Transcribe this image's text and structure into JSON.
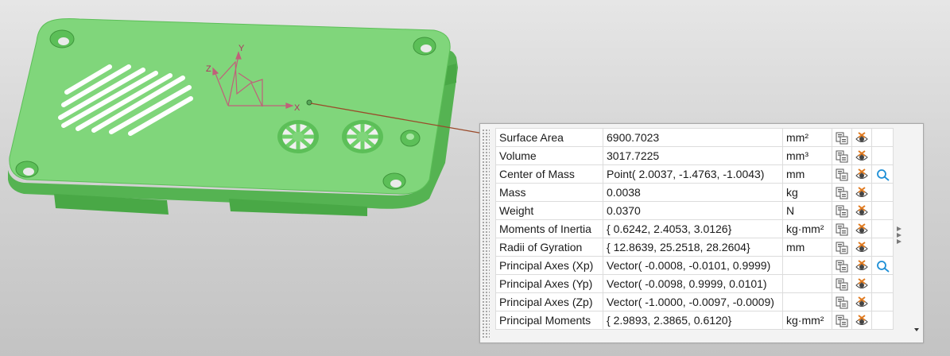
{
  "colors": {
    "part_green": "#7fd57a",
    "part_dark": "#3fa33c",
    "leader": "#9a4a2a",
    "csys_magenta": "#b03060"
  },
  "csys": {
    "x_label": "X",
    "y_label": "Y",
    "z_label": "Z"
  },
  "properties": {
    "rows": [
      {
        "name": "Surface Area",
        "value": "6900.7023",
        "unit": "mm²",
        "has_target": false
      },
      {
        "name": "Volume",
        "value": "3017.7225",
        "unit": "mm³",
        "has_target": false
      },
      {
        "name": "Center of Mass",
        "value": "Point( 2.0037, -1.4763, -1.0043)",
        "unit": "mm",
        "has_target": true
      },
      {
        "name": "Mass",
        "value": "0.0038",
        "unit": "kg",
        "has_target": false
      },
      {
        "name": "Weight",
        "value": "0.0370",
        "unit": "N",
        "has_target": false
      },
      {
        "name": "Moments of Inertia",
        "value": "{ 0.6242, 2.4053, 3.0126}",
        "unit": "kg·mm²",
        "has_target": false
      },
      {
        "name": "Radii of Gyration",
        "value": "{ 12.8639, 25.2518, 28.2604}",
        "unit": "mm",
        "has_target": false
      },
      {
        "name": "Principal Axes (Xp)",
        "value": "Vector( -0.0008, -0.0101, 0.9999)",
        "unit": "",
        "has_target": true
      },
      {
        "name": "Principal Axes (Yp)",
        "value": "Vector( -0.0098, 0.9999, 0.0101)",
        "unit": "",
        "has_target": false
      },
      {
        "name": "Principal Axes (Zp)",
        "value": "Vector( -1.0000, -0.0097, -0.0009)",
        "unit": "",
        "has_target": false
      },
      {
        "name": "Principal Moments",
        "value": "{ 2.9893, 2.3865, 0.6120}",
        "unit": "kg·mm²",
        "has_target": false
      }
    ]
  },
  "icons": {
    "copy": "copy-to-clipboard-icon",
    "visibility": "show-hide-eye-icon",
    "target": "show-point-icon"
  }
}
